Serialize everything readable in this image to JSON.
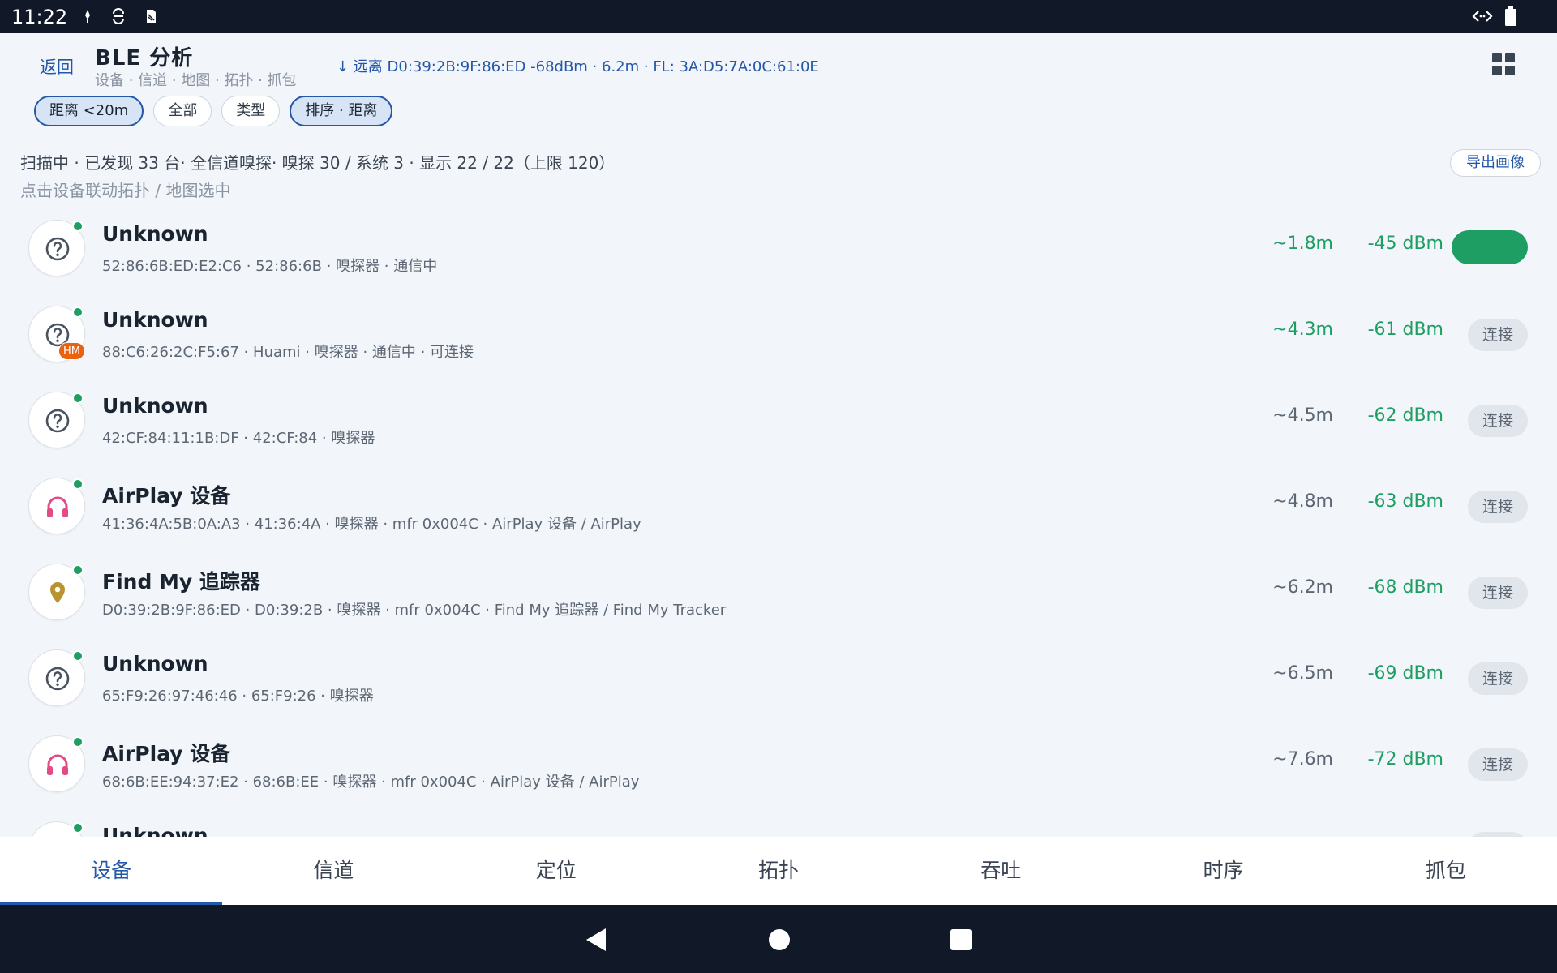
{
  "status_bar": {
    "time": "11:22",
    "left_icons": [
      "mic-icon",
      "sync-icon",
      "sdcard-icon"
    ],
    "right_icons": [
      "vpn-arrows-icon",
      "battery-icon"
    ]
  },
  "header": {
    "back_label": "返回",
    "title": "BLE 分析",
    "subtitle": "设备 · 信道 · 地图 · 拓扑 · 抓包",
    "selection_info": "↓ 远离 D0:39:2B:9F:86:ED -68dBm · 6.2m  ·  FL: 3A:D5:7A:0C:61:0E",
    "grid_icon": "grid-icon"
  },
  "chips": [
    {
      "label": "距离 <20m",
      "active": true
    },
    {
      "label": "全部",
      "active": false
    },
    {
      "label": "类型",
      "active": false
    },
    {
      "label": "排序 · 距离",
      "active": true
    }
  ],
  "summary": {
    "line1": "扫描中 · 已发现 33 台· 全信道嗅探· 嗅探 30 / 系统 3 · 显示 22 / 22（上限 120）",
    "line2": "点击设备联动拓扑 / 地图选中",
    "export_label": "导出画像"
  },
  "colors": {
    "accent": "#2357a8",
    "signal_green": "#1e9e63",
    "badge_orange": "#e8620f",
    "airplay_pink": "#e24b86",
    "findmy_gold": "#b8932f"
  },
  "devices": [
    {
      "name": "Unknown",
      "meta": "52:86:6B:ED:E2:C6 · 52:86:6B · 嗅探器 · 通信中",
      "distance": "~1.8m",
      "rssi": "-45 dBm",
      "icon": "question-icon",
      "badge": null,
      "action": "",
      "connected": true
    },
    {
      "name": "Unknown",
      "meta": "88:C6:26:2C:F5:67 · Huami · 嗅探器 · 通信中 · 可连接",
      "distance": "~4.3m",
      "rssi": "-61 dBm",
      "icon": "question-icon",
      "badge": "HM",
      "action": "连接",
      "connected": false
    },
    {
      "name": "Unknown",
      "meta": "42:CF:84:11:1B:DF · 42:CF:84 · 嗅探器",
      "distance": "~4.5m",
      "rssi": "-62 dBm",
      "icon": "question-icon",
      "badge": null,
      "action": "连接",
      "connected": false
    },
    {
      "name": "AirPlay 设备",
      "meta": "41:36:4A:5B:0A:A3 · 41:36:4A · 嗅探器 · mfr 0x004C · AirPlay 设备 / AirPlay",
      "distance": "~4.8m",
      "rssi": "-63 dBm",
      "icon": "headphones-icon",
      "badge": null,
      "action": "连接",
      "connected": false
    },
    {
      "name": "Find My 追踪器",
      "meta": "D0:39:2B:9F:86:ED · D0:39:2B · 嗅探器 · mfr 0x004C · Find My 追踪器 / Find My Tracker",
      "distance": "~6.2m",
      "rssi": "-68 dBm",
      "icon": "location-pin-icon",
      "badge": null,
      "action": "连接",
      "connected": false
    },
    {
      "name": "Unknown",
      "meta": "65:F9:26:97:46:46 · 65:F9:26 · 嗅探器",
      "distance": "~6.5m",
      "rssi": "-69 dBm",
      "icon": "question-icon",
      "badge": null,
      "action": "连接",
      "connected": false
    },
    {
      "name": "AirPlay 设备",
      "meta": "68:6B:EE:94:37:E2 · 68:6B:EE · 嗅探器 · mfr 0x004C · AirPlay 设备 / AirPlay",
      "distance": "~7.6m",
      "rssi": "-72 dBm",
      "icon": "headphones-icon",
      "badge": null,
      "action": "连接",
      "connected": false
    },
    {
      "name": "Unknown",
      "meta": "",
      "distance": "",
      "rssi": "",
      "icon": "question-icon",
      "badge": null,
      "action": "",
      "connected": false
    }
  ],
  "tabs": [
    {
      "label": "设备",
      "active": true
    },
    {
      "label": "信道",
      "active": false
    },
    {
      "label": "定位",
      "active": false
    },
    {
      "label": "拓扑",
      "active": false
    },
    {
      "label": "吞吐",
      "active": false
    },
    {
      "label": "时序",
      "active": false
    },
    {
      "label": "抓包",
      "active": false
    }
  ],
  "nav_bar": {
    "icons": [
      "nav-back-icon",
      "nav-home-icon",
      "nav-recents-icon"
    ]
  }
}
